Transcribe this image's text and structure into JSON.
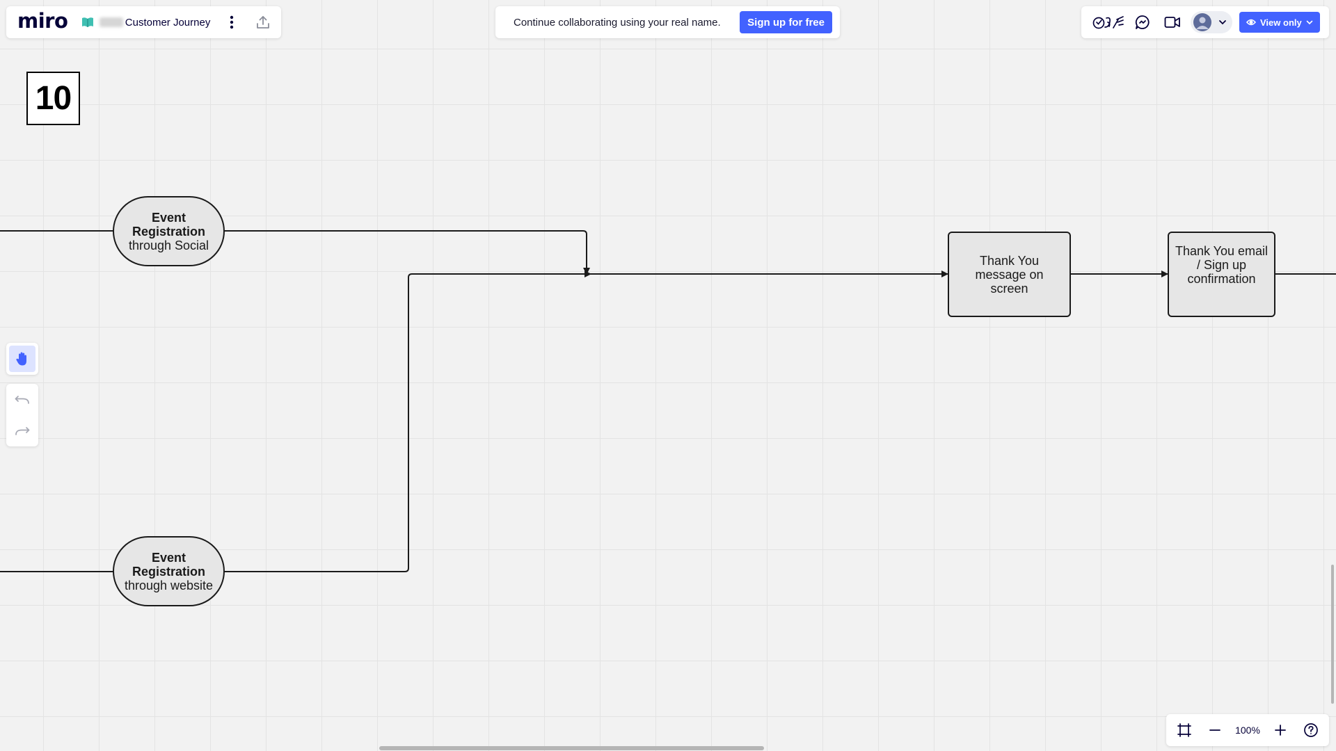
{
  "header": {
    "logo": "miro",
    "board_name": "Customer Journey",
    "banner_text": "Continue collaborating using your real name.",
    "signup_label": "Sign up for free",
    "view_only_label": "View only"
  },
  "canvas": {
    "frame_number": "10",
    "shapes": {
      "social": {
        "title": "Event Registration",
        "subtitle": "through Social"
      },
      "website": {
        "title": "Event Registration",
        "subtitle": "through website"
      },
      "thank_you_screen": {
        "text": "Thank You message on screen"
      },
      "thank_you_email": {
        "text": "Thank You email / Sign up confirmation"
      }
    }
  },
  "zoom": {
    "level": "100%"
  },
  "colors": {
    "accent": "#4262ff",
    "shape_fill": "#e6e6e6",
    "stroke": "#1a1a1a"
  },
  "icons": [
    "board-icon",
    "more-icon",
    "export-icon",
    "reactions-icon",
    "comments-icon",
    "video-icon",
    "avatar-icon",
    "chevron-down-icon",
    "eye-icon",
    "hand-icon",
    "undo-icon",
    "redo-icon",
    "fit-frame-icon",
    "zoom-out-icon",
    "zoom-in-icon",
    "help-icon"
  ]
}
